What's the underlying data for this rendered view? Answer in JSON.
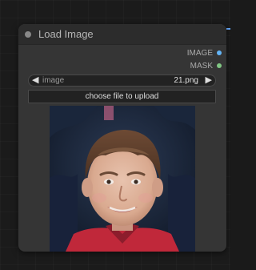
{
  "node": {
    "title": "Load Image",
    "outputs": [
      {
        "label": "IMAGE",
        "color": "#64b5f6"
      },
      {
        "label": "MASK",
        "color": "#81c784"
      }
    ],
    "image_widget": {
      "label": "image",
      "value": "21.png",
      "left_arrow": "◀",
      "right_arrow": "▶"
    },
    "upload_button": {
      "label": "choose file to upload"
    },
    "preview": {
      "alt": "uploaded image preview"
    }
  },
  "icons": {
    "collapse": "collapse-dot-icon",
    "prev": "left-arrow-icon",
    "next": "right-arrow-icon"
  }
}
